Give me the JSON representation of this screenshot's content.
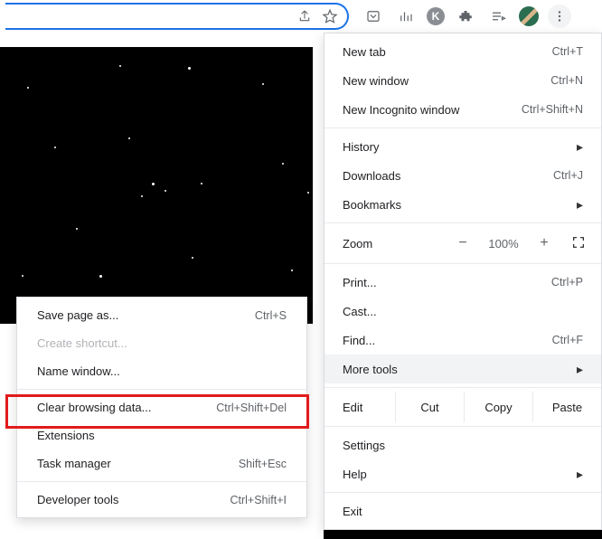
{
  "toolbar": {
    "share_icon": "share-icon",
    "star_icon": "star-icon",
    "ext_icons": [
      "pocket-icon",
      "stats-icon",
      "k-icon",
      "puzzle-icon",
      "playlist-icon"
    ],
    "avatar": "avatar",
    "more_icon": "more-vert-icon"
  },
  "menu": {
    "new_tab": {
      "label": "New tab",
      "shortcut": "Ctrl+T"
    },
    "new_window": {
      "label": "New window",
      "shortcut": "Ctrl+N"
    },
    "new_incognito": {
      "label": "New Incognito window",
      "shortcut": "Ctrl+Shift+N"
    },
    "history": {
      "label": "History"
    },
    "downloads": {
      "label": "Downloads",
      "shortcut": "Ctrl+J"
    },
    "bookmarks": {
      "label": "Bookmarks"
    },
    "zoom": {
      "label": "Zoom",
      "minus": "−",
      "value": "100%",
      "plus": "+"
    },
    "print": {
      "label": "Print...",
      "shortcut": "Ctrl+P"
    },
    "cast": {
      "label": "Cast..."
    },
    "find": {
      "label": "Find...",
      "shortcut": "Ctrl+F"
    },
    "more_tools": {
      "label": "More tools"
    },
    "edit": {
      "label": "Edit",
      "cut": "Cut",
      "copy": "Copy",
      "paste": "Paste"
    },
    "settings": {
      "label": "Settings"
    },
    "help": {
      "label": "Help"
    },
    "exit": {
      "label": "Exit"
    }
  },
  "submenu": {
    "save_page": {
      "label": "Save page as...",
      "shortcut": "Ctrl+S"
    },
    "create_shortcut": {
      "label": "Create shortcut..."
    },
    "name_window": {
      "label": "Name window..."
    },
    "clear_browsing": {
      "label": "Clear browsing data...",
      "shortcut": "Ctrl+Shift+Del"
    },
    "extensions": {
      "label": "Extensions"
    },
    "task_manager": {
      "label": "Task manager",
      "shortcut": "Shift+Esc"
    },
    "developer_tools": {
      "label": "Developer tools",
      "shortcut": "Ctrl+Shift+I"
    }
  },
  "annotation": {
    "highlight_target": "clear-browsing-data-item"
  }
}
